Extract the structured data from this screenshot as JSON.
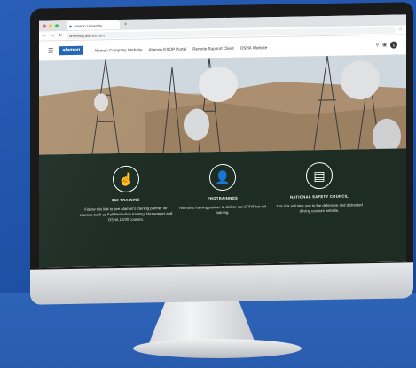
{
  "browser": {
    "tab_title": "Alamon University",
    "tab_new": "+",
    "url": "university.alamon.com"
  },
  "site": {
    "logo": "alamon",
    "nav_links": [
      {
        "label": "Alamon Company Website"
      },
      {
        "label": "Alamon ESOP Portal"
      },
      {
        "label": "Remote Support Client"
      },
      {
        "label": "OSHA Website"
      }
    ],
    "avatar_initial": "S"
  },
  "cards": [
    {
      "title": "360 TRAINING",
      "description": "Follow this link to see Alamon's training partner for courses such as Fall Protection training, Hazwopper and OSHA 10/30 courses."
    },
    {
      "title": "PROTRAINNGS",
      "description": "Alamon's training partner to deliver our CPR/First aid training."
    },
    {
      "title": "NATIONAL SAFETY COUNCIL",
      "description": "This link will take you to the defensive and distracted driving courses website."
    }
  ]
}
